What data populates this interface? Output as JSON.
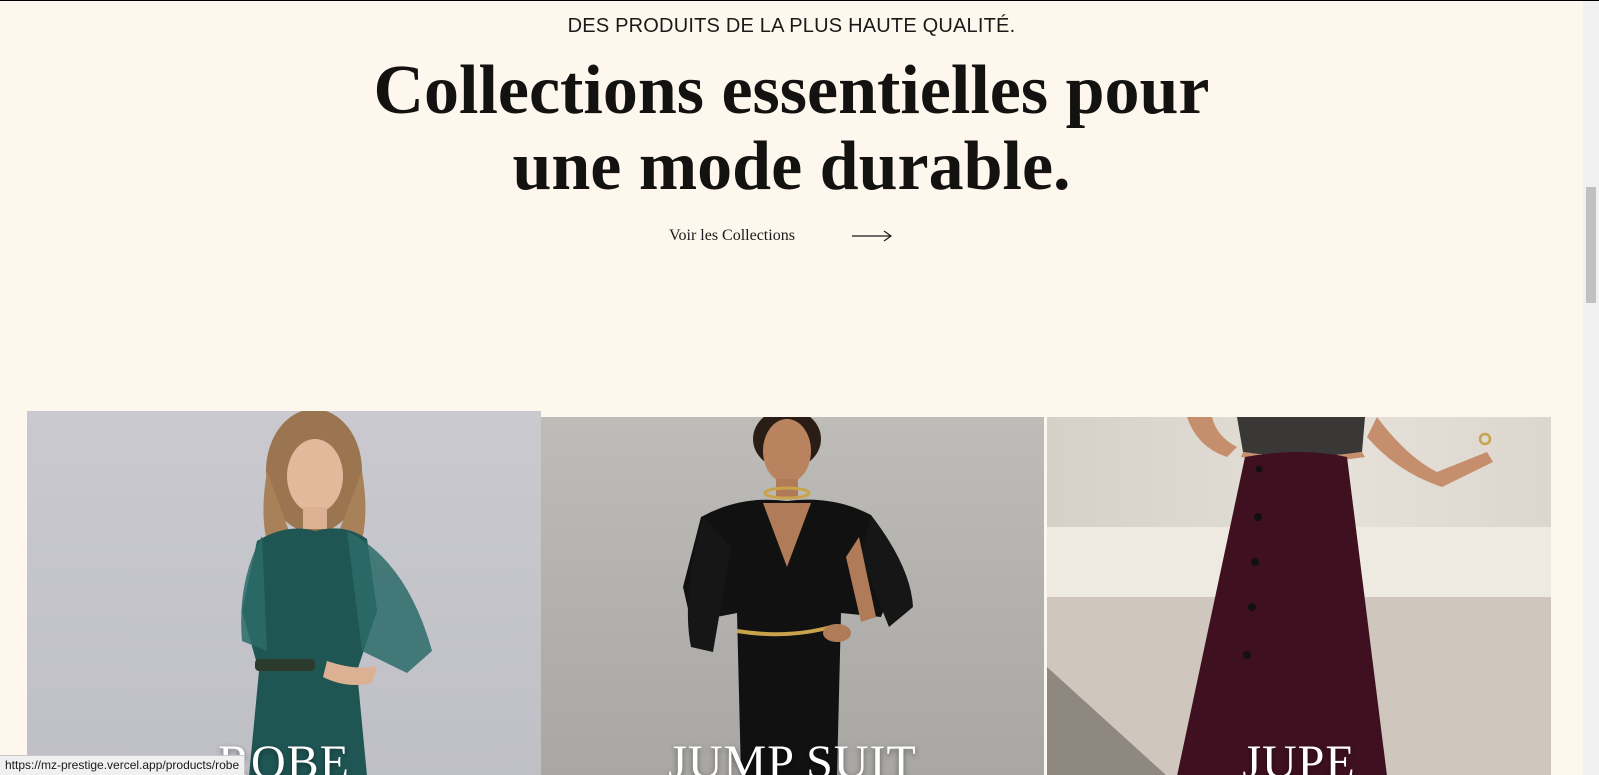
{
  "hero": {
    "eyebrow": "DES PRODUITS DE LA PLUS HAUTE QUALITÉ.",
    "headline_line1": "Collections essentielles pour",
    "headline_line2": "une mode durable.",
    "cta_label": "Voir les Collections",
    "cta_icon": "arrow-right-icon"
  },
  "categories": [
    {
      "label": "ROBE",
      "image": "woman-in-teal-dress-photo"
    },
    {
      "label": "JUMP SUIT",
      "image": "woman-in-black-jumpsuit-photo"
    },
    {
      "label": "JUPE",
      "image": "woman-in-burgundy-skirt-photo"
    }
  ],
  "status_bar": {
    "url": "https://mz-prestige.vercel.app/products/robe"
  },
  "colors": {
    "background": "#fdf7ed",
    "text": "#1a1a1a"
  }
}
